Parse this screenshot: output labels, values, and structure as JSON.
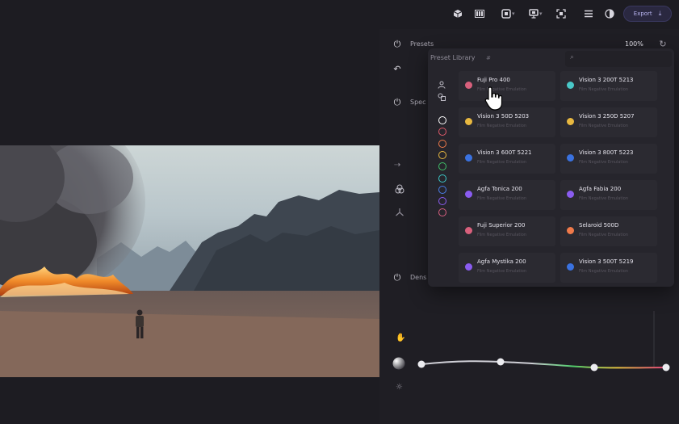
{
  "topbar": {
    "icons": [
      "cube-icon",
      "columns-icon",
      "frame-icon",
      "monitor-icon",
      "fit-screen-icon",
      "menu-icon",
      "contrast-icon"
    ],
    "export_label": "Export"
  },
  "panel": {
    "presets_label": "Presets",
    "zoom": "100%",
    "spec_label": "Spec",
    "dens_label": "Dens"
  },
  "library": {
    "title": "Preset Library",
    "hash": "#",
    "filter_colors": [
      "#ffffff",
      "#e05a6a",
      "#f07a4a",
      "#e8b840",
      "#3fbf68",
      "#3cc8c8",
      "#4a7ee8",
      "#8a5cf0",
      "#d85f80"
    ],
    "cards": [
      {
        "name": "Fuji Pro 400",
        "sub": "Film Negative Emulation",
        "color": "#d8607c"
      },
      {
        "name": "Vision 3 200T 5213",
        "sub": "Film Negative Emulation",
        "color": "#49c8c8"
      },
      {
        "name": "Vision 3 50D 5203",
        "sub": "Film Negative Emulation",
        "color": "#e8b840"
      },
      {
        "name": "Vision 3 250D 5207",
        "sub": "Film Negative Emulation",
        "color": "#e8b840"
      },
      {
        "name": "Vision 3 600T 5221",
        "sub": "Film Negative Emulation",
        "color": "#3a72e0"
      },
      {
        "name": "Vision 3 800T 5223",
        "sub": "Film Negative Emulation",
        "color": "#3a72e0"
      },
      {
        "name": "Agfa Tonica 200",
        "sub": "Film Negative Emulation",
        "color": "#8a5cf0"
      },
      {
        "name": "Agfa Fabia 200",
        "sub": "Film Negative Emulation",
        "color": "#8a5cf0"
      },
      {
        "name": "Fuji Superior 200",
        "sub": "Film Negative Emulation",
        "color": "#d8607c"
      },
      {
        "name": "Selaroid 500D",
        "sub": "Film Negative Emulation",
        "color": "#f07a4a"
      },
      {
        "name": "Agfa Mystika 200",
        "sub": "Film Negative Emulation",
        "color": "#8a5cf0"
      },
      {
        "name": "Vision 3 500T 5219",
        "sub": "Film Negative Emulation",
        "color": "#3a72e0"
      }
    ]
  }
}
